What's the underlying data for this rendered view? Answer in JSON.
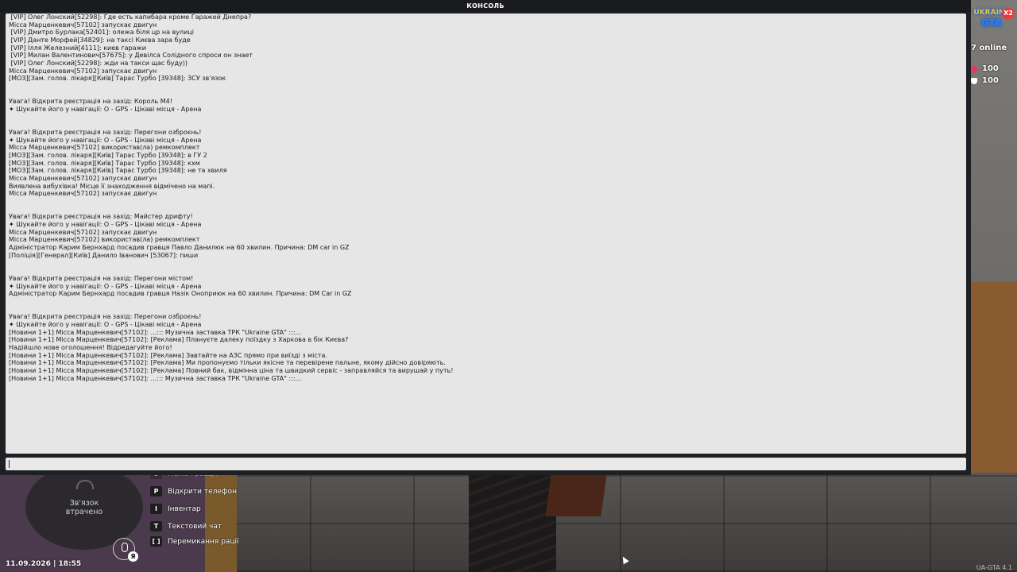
{
  "console": {
    "title": "КОНСОЛЬ",
    "lines": [
      " [VIP] Олег Лонский[52298]: Где есть капибара кроме Гаражей Днепра?",
      "Місса Марценкевич[57102] запускає двигун",
      " [VIP] Дмитро Бурлака[52401]: олежа біля цр на вулиці",
      " [VIP] Данте Морфей[34829]: на таксі Києва зара буде",
      " [VIP] Ілля Железний[4111]: киев гаражи",
      " [VIP] Милан Валентинович[57675]: у Девілса Солідного спроси он знает",
      " [VIP] Олег Лонский[52298]: жди на такси щас буду))",
      "Місса Марценкевич[57102] запускає двигун",
      "[МОЗ][Зам. голов. лікаря][Київ] Тарас Турбо [39348]: ЗСУ зв'язок",
      "",
      "",
      "Увага! Відкрита реєстрація на захід: Король М4!",
      "✦ Шукайте його у навігації: O - GPS - Цікаві місця - Арена",
      "",
      "",
      "Увага! Відкрита реєстрація на захід: Перегони озброєнь!",
      "✦ Шукайте його у навігації: O - GPS - Цікаві місця - Арена",
      "Місса Марценкевич[57102] використав(ла) ремкомплект",
      "[МОЗ][Зам. голов. лікаря][Київ] Тарас Турбо [39348]: в ГУ 2",
      "[МОЗ][Зам. голов. лікаря][Київ] Тарас Турбо [39348]: кхм",
      "[МОЗ][Зам. голов. лікаря][Київ] Тарас Турбо [39348]: не та хвиля",
      "Місса Марценкевич[57102] запускає двигун",
      "Виявлена вибухівка! Місце її знаходження відмічено на мапі.",
      "Місса Марценкевич[57102] запускає двигун",
      "",
      "",
      "Увага! Відкрита реєстрація на захід: Майстер дрифту!",
      "✦ Шукайте його у навігації: O - GPS - Цікаві місця - Арена",
      "Місса Марценкевич[57102] запускає двигун",
      "Місса Марценкевич[57102] використав(ла) ремкомплект",
      "Адміністратор Карим Бернхард посадив гравця Павло Данилюк на 60 хвилин. Причина: DM car in GZ",
      "[Поліція][Генерал][Київ] Данило Іванович [53067]: пиши",
      "",
      "",
      "Увага! Відкрита реєстрація на захід: Перегони містом!",
      "✦ Шукайте його у навігації: O - GPS - Цікаві місця - Арена",
      "Адміністратор Карим Бернхард посадив гравця Назік Оноприюк на 60 хвилин. Причина: DM Car in GZ",
      "",
      "",
      "Увага! Відкрита реєстрація на захід: Перегони озброєнь!",
      "✦ Шукайте його у навігації: O - GPS - Цікаві місця - Арена",
      "[Новини 1+1] Місса Марценкевич[57102]: ...::: Музична заставка ТРК \"Ukraine GTA\" :::...",
      "[Новини 1+1] Місса Марценкевич[57102]: [Реклама] Плануєте далеку поїздку з Харкова в бік Києва?",
      "Надійшло нове оголошення! Відредагуйте його!",
      "[Новини 1+1] Місса Марценкевич[57102]: [Реклама] Завтайте на АЗС прямо при виїзді з міста.",
      "[Новини 1+1] Місса Марценкевич[57102]: [Реклама] Ми пропонуємо тільки якісне та перевірене пальне, якому дійсно довіряють.",
      "[Новини 1+1] Місса Марценкевич[57102]: [Реклама] Повний бак, відмінна ціна та швидкий сервіс - заправляйся та вирушай у путь!",
      "[Новини 1+1] Місса Марценкевич[57102]: ...::: Музична заставка ТРК \"Ukraine GTA\" :::..."
    ],
    "input_value": ""
  },
  "hud": {
    "logo_top": "UKRAINE",
    "logo_bottom": "GTA",
    "multiplier_badge": "X2",
    "online": "7 online",
    "health": "100",
    "armor": "100",
    "minimap_status": "Зв'язок\nвтрачено",
    "voice_key": "Я",
    "datetime": "11.09.2026 | 18:55",
    "version": "UA-GTA 4.1",
    "hints": [
      {
        "key": "O",
        "label": "Меню гравця",
        "faded": true
      },
      {
        "key": "P",
        "label": "Відкрити телефон",
        "faded": false
      },
      {
        "key": "I",
        "label": "Інвентар",
        "faded": false
      },
      {
        "key": "T",
        "label": "Текстовий чат",
        "faded": false
      },
      {
        "key": "[  ]",
        "label": "Перемикання рації",
        "faded": false
      }
    ]
  },
  "colors": {
    "console_bg": "#e6e6e6",
    "console_frame": "#1f2023",
    "titlebar": "#1a1b1e",
    "accent_health": "#e23a5a"
  }
}
